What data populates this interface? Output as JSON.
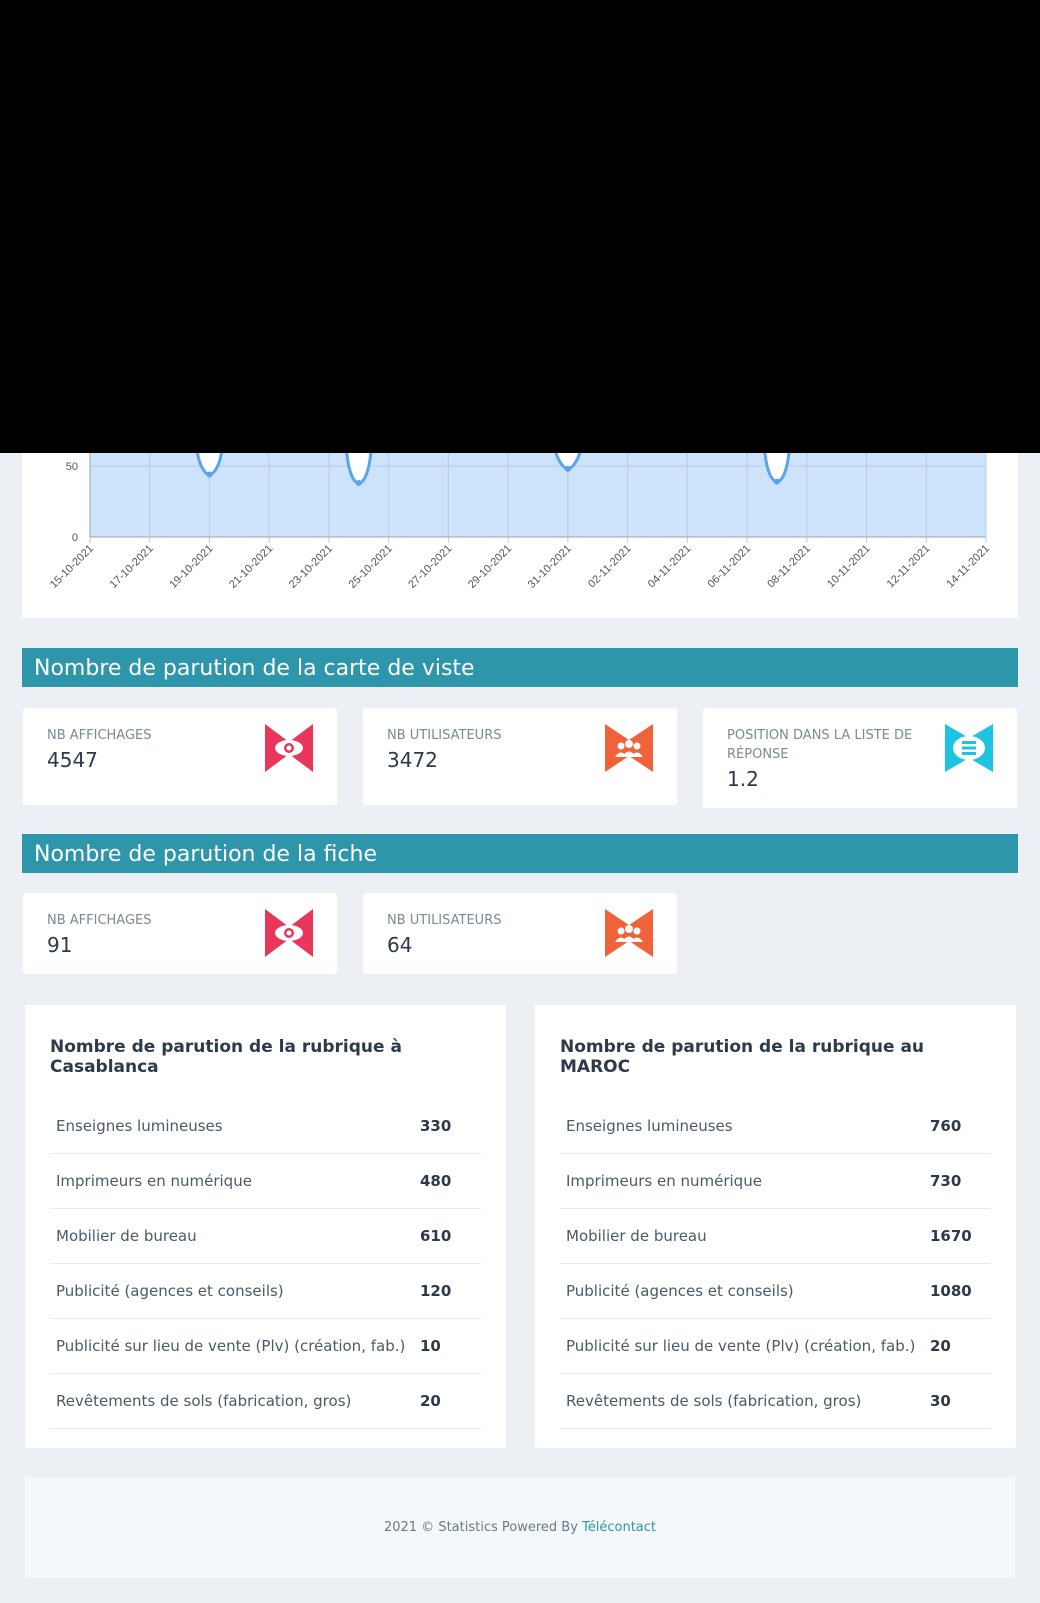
{
  "chart_data": {
    "type": "area",
    "x": [
      "15-10-2021",
      "16-10-2021",
      "17-10-2021",
      "18-10-2021",
      "19-10-2021",
      "20-10-2021",
      "21-10-2021",
      "22-10-2021",
      "23-10-2021",
      "24-10-2021",
      "25-10-2021",
      "26-10-2021",
      "27-10-2021",
      "28-10-2021",
      "29-10-2021",
      "30-10-2021",
      "31-10-2021",
      "01-11-2021",
      "02-11-2021",
      "03-11-2021",
      "04-11-2021",
      "05-11-2021",
      "06-11-2021",
      "07-11-2021",
      "08-11-2021",
      "09-11-2021",
      "10-11-2021",
      "11-11-2021",
      "12-11-2021",
      "13-11-2021",
      "14-11-2021"
    ],
    "tick_labels": [
      "15-10-2021",
      "17-10-2021",
      "19-10-2021",
      "21-10-2021",
      "23-10-2021",
      "25-10-2021",
      "27-10-2021",
      "29-10-2021",
      "31-10-2021",
      "02-11-2021",
      "04-11-2021",
      "06-11-2021",
      "08-11-2021",
      "10-11-2021",
      "12-11-2021",
      "14-11-2021"
    ],
    "visible_points": [
      {
        "x": "19-10-2021",
        "y": 44
      },
      {
        "x": "24-10-2021",
        "y": 38
      },
      {
        "x": "31-10-2021",
        "y": 48
      },
      {
        "x": "07-11-2021",
        "y": 39
      }
    ],
    "y_ticks": [
      "0",
      "50"
    ],
    "ylim": [
      0,
      50
    ],
    "grid": true,
    "fill_color": "#cde3fb",
    "line_color": "#5aa4ea"
  },
  "sections": {
    "carte": {
      "title": "Nombre de parution de la carte de viste"
    },
    "fiche": {
      "title": "Nombre de parution de la fiche"
    }
  },
  "carte_stats": [
    {
      "label": "NB AFFICHAGES",
      "value": "4547",
      "icon": "eye-icon",
      "color": "#e8375a"
    },
    {
      "label": "NB UTILISATEURS",
      "value": "3472",
      "icon": "users-icon",
      "color": "#f0623a"
    },
    {
      "label": "POSITION DANS LA LISTE DE RÉPONSE",
      "value": "1.2",
      "icon": "list-icon",
      "color": "#1dc3e0"
    }
  ],
  "fiche_stats": [
    {
      "label": "NB AFFICHAGES",
      "value": "91",
      "icon": "eye-icon",
      "color": "#e8375a"
    },
    {
      "label": "NB UTILISATEURS",
      "value": "64",
      "icon": "users-icon",
      "color": "#f0623a"
    }
  ],
  "rubrique_casablanca": {
    "title": "Nombre de parution de la rubrique à Casablanca",
    "rows": [
      {
        "label": "Enseignes lumineuses",
        "value": "330"
      },
      {
        "label": "Imprimeurs en numérique",
        "value": "480"
      },
      {
        "label": "Mobilier de bureau",
        "value": "610"
      },
      {
        "label": "Publicité (agences et conseils)",
        "value": "120"
      },
      {
        "label": "Publicité sur lieu de vente (Plv) (création, fab.)",
        "value": "10"
      },
      {
        "label": "Revêtements de sols (fabrication, gros)",
        "value": "20"
      }
    ]
  },
  "rubrique_maroc": {
    "title": "Nombre de parution de la rubrique au MAROC",
    "rows": [
      {
        "label": "Enseignes lumineuses",
        "value": "760"
      },
      {
        "label": "Imprimeurs en numérique",
        "value": "730"
      },
      {
        "label": "Mobilier de bureau",
        "value": "1670"
      },
      {
        "label": "Publicité (agences et conseils)",
        "value": "1080"
      },
      {
        "label": "Publicité sur lieu de vente (Plv) (création, fab.)",
        "value": "20"
      },
      {
        "label": "Revêtements de sols (fabrication, gros)",
        "value": "30"
      }
    ]
  },
  "footer": {
    "text": "2021 © Statistics Powered By ",
    "link": "Télécontact"
  }
}
